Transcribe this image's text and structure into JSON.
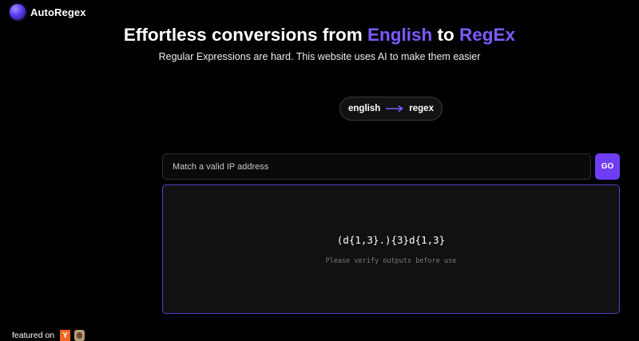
{
  "brand": {
    "name": "AutoRegex"
  },
  "hero": {
    "title_part1": "Effortless conversions from ",
    "title_english": "English",
    "title_part2": " to ",
    "title_regex": "RegEx",
    "subtitle": "Regular Expressions are hard. This website uses AI to make them easier"
  },
  "mode_toggle": {
    "from_label": "english",
    "to_label": "regex",
    "arrow_icon": "long-right-arrow-icon"
  },
  "prompt": {
    "placeholder": "Match a valid IP address",
    "go_label": "GO"
  },
  "result": {
    "regex": "(d{1,3}.){3}d{1,3}",
    "note": "Please verify outputs before use"
  },
  "footer": {
    "featured_label": "featured on",
    "icons": [
      "y-combinator-icon",
      "product-hunt-kitty-icon"
    ],
    "yc_letter": "Y"
  },
  "colors": {
    "background": "#000000",
    "accent": "#7b5cff",
    "button": "#6e3df5",
    "result_border": "#5b3cc4"
  }
}
